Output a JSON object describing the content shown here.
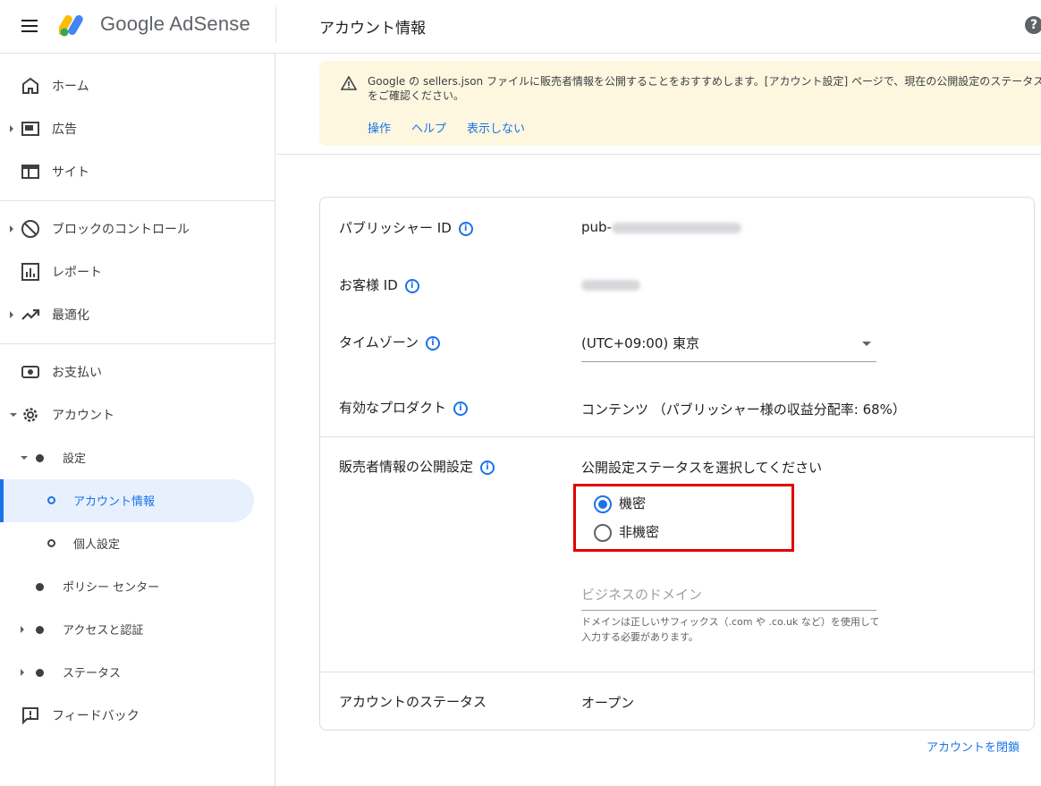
{
  "header": {
    "app_name": "Google AdSense",
    "page_title": "アカウント情報",
    "help_symbol": "?"
  },
  "sidebar": {
    "items": [
      {
        "label": "ホーム"
      },
      {
        "label": "広告"
      },
      {
        "label": "サイト"
      },
      {
        "label": "ブロックのコントロール"
      },
      {
        "label": "レポート"
      },
      {
        "label": "最適化"
      },
      {
        "label": "お支払い"
      },
      {
        "label": "アカウント"
      },
      {
        "label": "設定"
      },
      {
        "label": "アカウント情報"
      },
      {
        "label": "個人設定"
      },
      {
        "label": "ポリシー センター"
      },
      {
        "label": "アクセスと認証"
      },
      {
        "label": "ステータス"
      },
      {
        "label": "フィードバック"
      }
    ]
  },
  "banner": {
    "text": "Google の sellers.json ファイルに販売者情報を公開することをおすすめします。[アカウント設定] ページで、現在の公開設定のステータスをご確認ください。",
    "links": [
      "操作",
      "ヘルプ",
      "表示しない"
    ]
  },
  "account": {
    "publisher_id_label": "パブリッシャー ID",
    "publisher_id_prefix": "pub-",
    "customer_id_label": "お客様 ID",
    "timezone_label": "タイムゾーン",
    "timezone_value": "(UTC+09:00) 東京",
    "products_label": "有効なプロダクト",
    "products_value": "コンテンツ （パブリッシャー様の収益分配率: 68%）",
    "seller_info_label": "販売者情報の公開設定",
    "seller_prompt": "公開設定ステータスを選択してください",
    "radio_confidential": "機密",
    "radio_non_confidential": "非機密",
    "domain_placeholder": "ビジネスのドメイン",
    "domain_help": "ドメインは正しいサフィックス（.com や .co.uk など）を使用して入力する必要があります。",
    "status_label": "アカウントのステータス",
    "status_value": "オープン",
    "close_account": "アカウントを閉鎖"
  },
  "colors": {
    "accent": "#1a73e8",
    "banner_bg": "#fef7e0",
    "highlight_box": "#e00000",
    "active_nav_bg": "#e8f0fe"
  }
}
